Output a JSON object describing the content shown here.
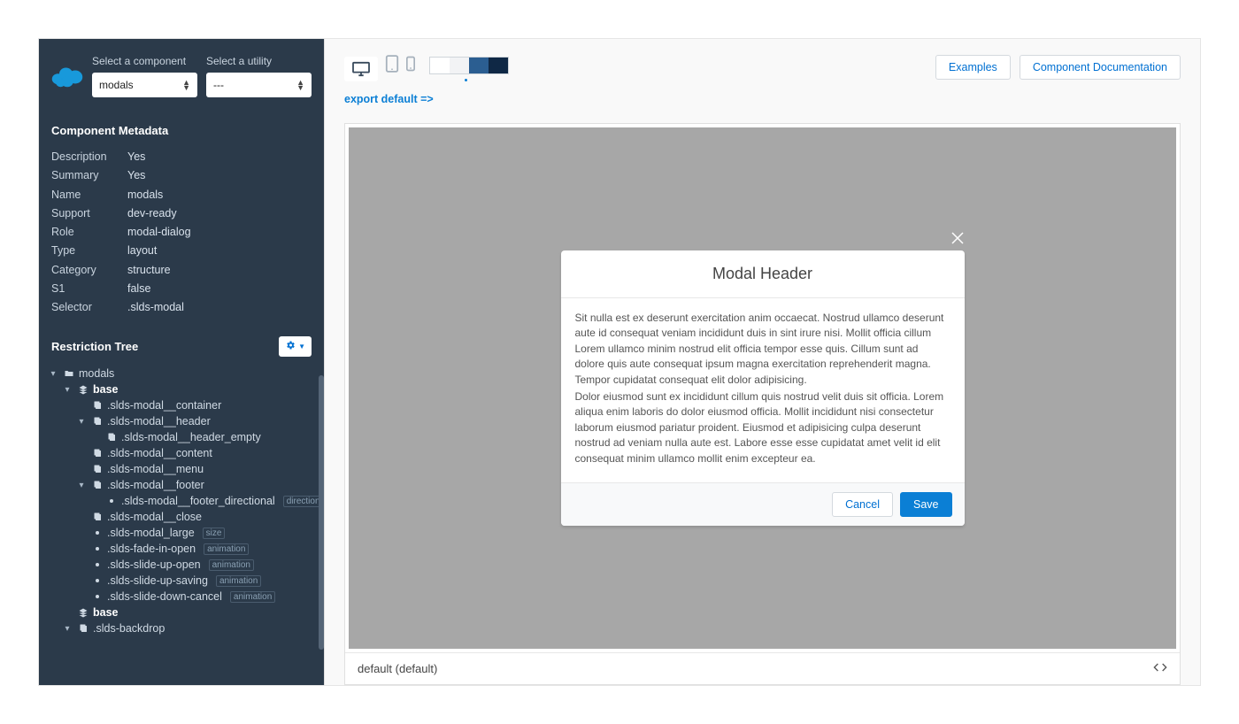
{
  "sidebar": {
    "component_label": "Select a component",
    "utility_label": "Select a utility",
    "component_value": "modals",
    "utility_value": "---",
    "metadata_title": "Component Metadata",
    "metadata": [
      {
        "k": "Description",
        "v": "Yes"
      },
      {
        "k": "Summary",
        "v": "Yes"
      },
      {
        "k": "Name",
        "v": "modals"
      },
      {
        "k": "Support",
        "v": "dev-ready"
      },
      {
        "k": "Role",
        "v": "modal-dialog"
      },
      {
        "k": "Type",
        "v": "layout"
      },
      {
        "k": "Category",
        "v": "structure"
      },
      {
        "k": "S1",
        "v": "false"
      },
      {
        "k": "Selector",
        "v": ".slds-modal"
      }
    ],
    "restriction_title": "Restriction Tree",
    "tree": {
      "root": "modals",
      "base1": "base",
      "container": ".slds-modal__container",
      "header": ".slds-modal__header",
      "header_empty": ".slds-modal__header_empty",
      "content": ".slds-modal__content",
      "menu": ".slds-modal__menu",
      "footer": ".slds-modal__footer",
      "footer_dir": ".slds-modal__footer_directional",
      "footer_dir_badge": "direction",
      "close": ".slds-modal__close",
      "large": ".slds-modal_large",
      "large_badge": "size",
      "fade": ".slds-fade-in-open",
      "slideup": ".slds-slide-up-open",
      "slidesave": ".slds-slide-up-saving",
      "slidedown": ".slds-slide-down-cancel",
      "anim_badge": "animation",
      "base2": "base",
      "backdrop": ".slds-backdrop"
    }
  },
  "toolbar": {
    "export_text": "export default =>",
    "examples": "Examples",
    "docs": "Component Documentation"
  },
  "modal": {
    "header": "Modal Header",
    "p1": "Sit nulla est ex deserunt exercitation anim occaecat. Nostrud ullamco deserunt aute id consequat veniam incididunt duis in sint irure nisi. Mollit officia cillum Lorem ullamco minim nostrud elit officia tempor esse quis. Cillum sunt ad dolore quis aute consequat ipsum magna exercitation reprehenderit magna. Tempor cupidatat consequat elit dolor adipisicing.",
    "p2": "Dolor eiusmod sunt ex incididunt cillum quis nostrud velit duis sit officia. Lorem aliqua enim laboris do dolor eiusmod officia. Mollit incididunt nisi consectetur laborum eiusmod pariatur proident. Eiusmod et adipisicing culpa deserunt nostrud ad veniam nulla aute est. Labore esse esse cupidatat amet velit id elit consequat minim ullamco mollit enim excepteur ea.",
    "cancel": "Cancel",
    "save": "Save"
  },
  "preview": {
    "footer_label": "default (default)"
  }
}
